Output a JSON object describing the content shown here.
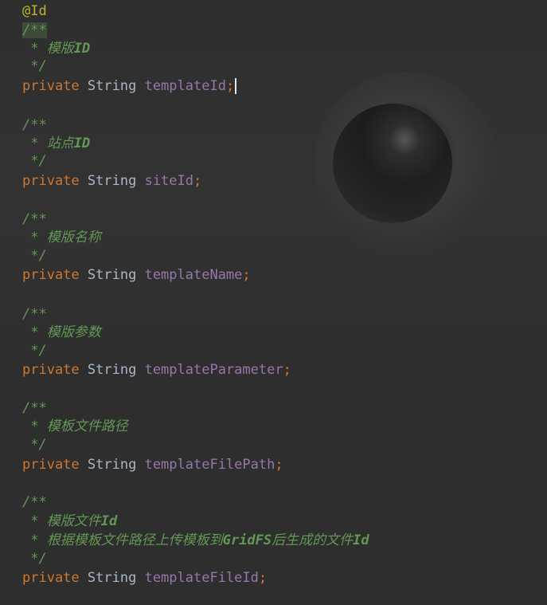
{
  "annotation": "@Id",
  "comment_open": "/**",
  "comment_close": " */",
  "comment_star": " * ",
  "keyword": "private",
  "type": "String",
  "semicolon": ";",
  "blocks": [
    {
      "comment_lines": [
        "模版",
        "ID"
      ],
      "field": "templateId"
    },
    {
      "comment_lines": [
        "站点",
        "ID"
      ],
      "field": "siteId"
    },
    {
      "comment_lines": [
        "模版名称"
      ],
      "field": "templateName"
    },
    {
      "comment_lines": [
        "模版参数"
      ],
      "field": "templateParameter"
    },
    {
      "comment_lines": [
        "模板文件路径"
      ],
      "field": "templateFilePath"
    },
    {
      "comment_lines": [
        "模版文件",
        "Id"
      ],
      "field": "templateFileId"
    }
  ],
  "extra_comment_line": [
    "根据模板文件路径上传模板到",
    "GridFS",
    "后生成的文件",
    "Id"
  ],
  "colors": {
    "background": "#2e2e2e",
    "annotation": "#bbb529",
    "comment": "#629755",
    "keyword": "#cc7832",
    "type": "#a9b7c6",
    "field": "#9876aa"
  }
}
